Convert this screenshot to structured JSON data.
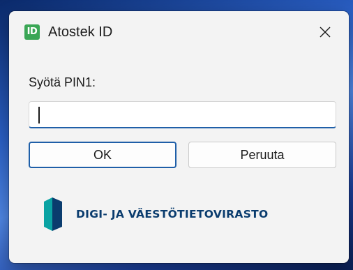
{
  "window": {
    "app_icon_text": "ID",
    "title": "Atostek ID",
    "close_icon": "close-icon"
  },
  "form": {
    "prompt": "Syötä PIN1:",
    "pin_value": ""
  },
  "buttons": {
    "ok_label": "OK",
    "cancel_label": "Peruuta"
  },
  "logo": {
    "text": "DIGI- JA VÄESTÖTIETOVIRASTO",
    "icon": "dvv-logo-icon"
  },
  "colors": {
    "accent": "#1f5fa8",
    "app_icon": "#3aa655",
    "logo_dark": "#0a3c6e",
    "logo_teal": "#0aa3a3"
  }
}
